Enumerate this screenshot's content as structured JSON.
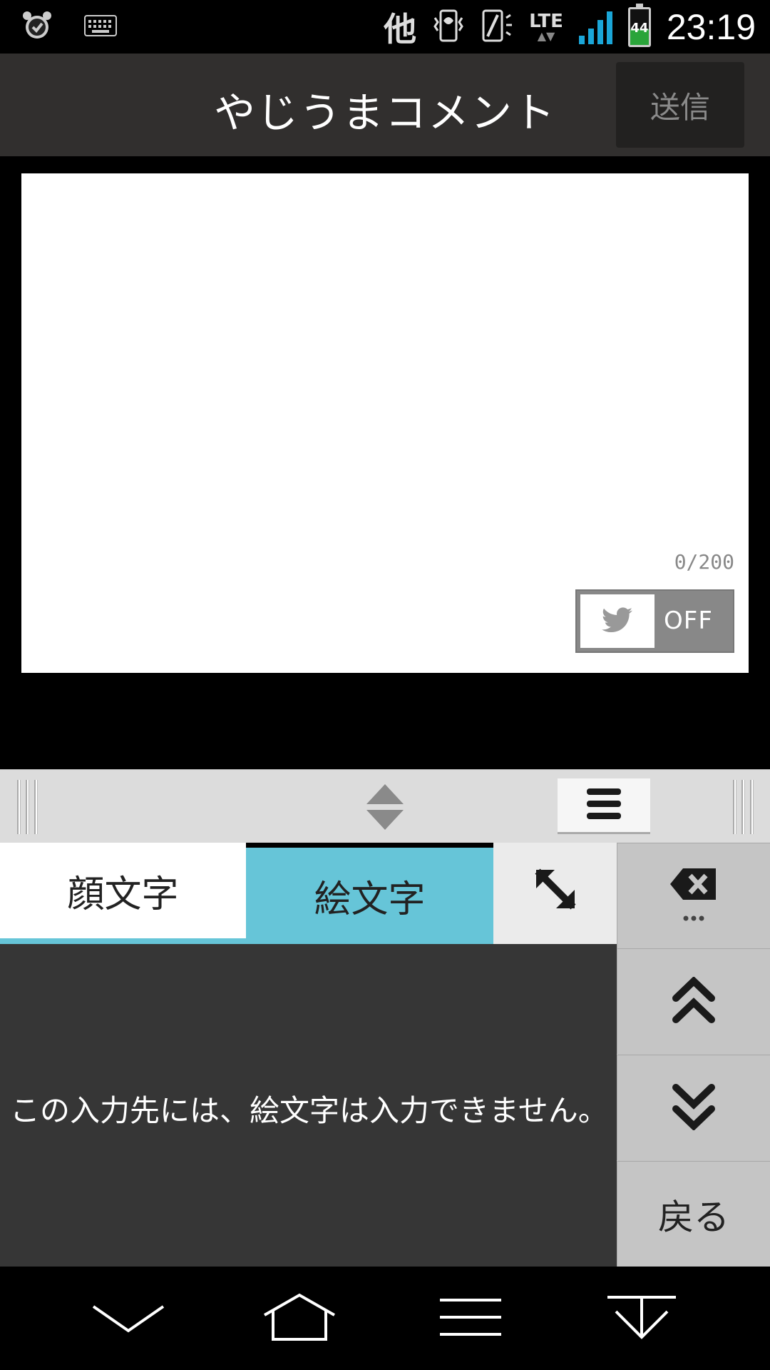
{
  "status_bar": {
    "other_label": "他",
    "network": "LTE",
    "battery": "44",
    "time": "23:19",
    "signal_color": "#1aa6d8"
  },
  "header": {
    "title": "やじうまコメント",
    "send_label": "送信"
  },
  "editor": {
    "value": "",
    "char_count": "0/200",
    "twitter_toggle_state": "OFF"
  },
  "keyboard": {
    "tabs": [
      {
        "label": "顔文字"
      },
      {
        "label": "絵文字"
      }
    ],
    "accent_color": "#66c5d8",
    "message": "この入力先には、絵文字は入力できません。",
    "side_keys": {
      "backspace_icon": "backspace-icon",
      "page_up_icon": "double-chevron-up-icon",
      "page_down_icon": "double-chevron-down-icon",
      "back_label": "戻る"
    }
  },
  "navbar": {
    "icons": [
      "chevron-down-icon",
      "home-icon",
      "menu-icon",
      "hide-keyboard-icon"
    ]
  }
}
